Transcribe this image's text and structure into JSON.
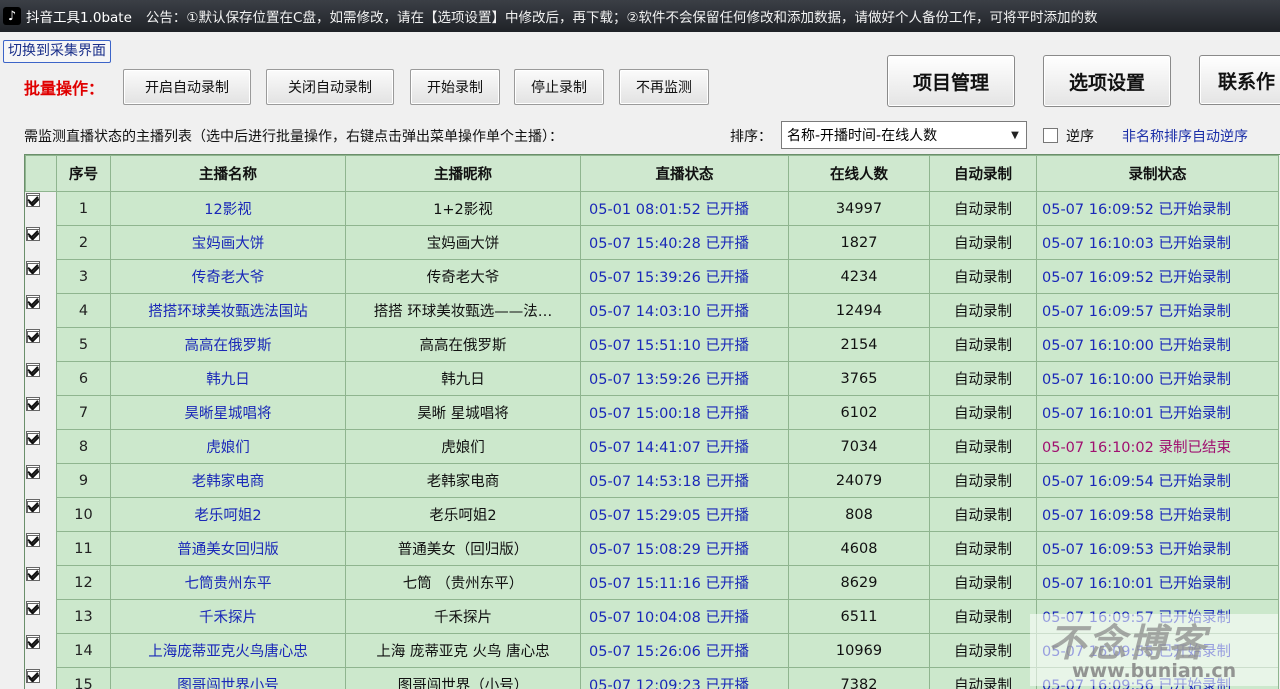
{
  "titlebar": {
    "app_title": "抖音工具1.0bate",
    "notice": "公告：①默认保存位置在C盘，如需修改，请在【选项设置】中修改后，再下载；②软件不会保留任何修改和添加数据，请做好个人备份工作，可将平时添加的数"
  },
  "switch_button": "切换到采集界面",
  "batch": {
    "label": "批量操作：",
    "buttons": [
      "开启自动录制",
      "关闭自动录制",
      "开始录制",
      "停止录制",
      "不再监测"
    ]
  },
  "top_buttons": [
    "项目管理",
    "选项设置",
    "联系作"
  ],
  "list_description": "需监测直播状态的主播列表（选中后进行批量操作，右键点击弹出菜单操作单个主播）：",
  "sort": {
    "label": "排序：",
    "value": "名称-开播时间-在线人数",
    "reverse_label": "逆序",
    "note": "非名称排序自动逆序"
  },
  "table": {
    "headers": [
      "",
      "序号",
      "主播名称",
      "主播昵称",
      "直播状态",
      "在线人数",
      "自动录制",
      "录制状态"
    ],
    "rows": [
      {
        "no": "1",
        "name": "12影视",
        "nick": "1+2影视",
        "live": "05-01  08:01:52  已开播",
        "online": "34997",
        "auto": "自动录制",
        "rec": "05-07  16:09:52  已开始录制",
        "ended": false
      },
      {
        "no": "2",
        "name": "宝妈画大饼",
        "nick": "宝妈画大饼",
        "live": "05-07  15:40:28  已开播",
        "online": "1827",
        "auto": "自动录制",
        "rec": "05-07  16:10:03  已开始录制",
        "ended": false
      },
      {
        "no": "3",
        "name": "传奇老大爷",
        "nick": "传奇老大爷",
        "live": "05-07  15:39:26  已开播",
        "online": "4234",
        "auto": "自动录制",
        "rec": "05-07  16:09:52  已开始录制",
        "ended": false
      },
      {
        "no": "4",
        "name": "搭搭环球美妆甄选法国站",
        "nick": "搭搭  环球美妆甄选——法…",
        "live": "05-07  14:03:10  已开播",
        "online": "12494",
        "auto": "自动录制",
        "rec": "05-07  16:09:57  已开始录制",
        "ended": false
      },
      {
        "no": "5",
        "name": "高高在俄罗斯",
        "nick": "高高在俄罗斯",
        "live": "05-07  15:51:10  已开播",
        "online": "2154",
        "auto": "自动录制",
        "rec": "05-07  16:10:00  已开始录制",
        "ended": false
      },
      {
        "no": "6",
        "name": "韩九日",
        "nick": "韩九日",
        "live": "05-07  13:59:26  已开播",
        "online": "3765",
        "auto": "自动录制",
        "rec": "05-07  16:10:00  已开始录制",
        "ended": false
      },
      {
        "no": "7",
        "name": "昊晰星城唱将",
        "nick": "昊晰  星城唱将",
        "live": "05-07  15:00:18  已开播",
        "online": "6102",
        "auto": "自动录制",
        "rec": "05-07  16:10:01  已开始录制",
        "ended": false
      },
      {
        "no": "8",
        "name": "虎娘们",
        "nick": "虎娘们",
        "live": "05-07  14:41:07  已开播",
        "online": "7034",
        "auto": "自动录制",
        "rec": "05-07  16:10:02  录制已结束",
        "ended": true
      },
      {
        "no": "9",
        "name": "老韩家电商",
        "nick": "老韩家电商",
        "live": "05-07  14:53:18  已开播",
        "online": "24079",
        "auto": "自动录制",
        "rec": "05-07  16:09:54  已开始录制",
        "ended": false
      },
      {
        "no": "10",
        "name": "老乐呵姐2",
        "nick": "老乐呵姐2",
        "live": "05-07  15:29:05  已开播",
        "online": "808",
        "auto": "自动录制",
        "rec": "05-07  16:09:58  已开始录制",
        "ended": false
      },
      {
        "no": "11",
        "name": "普通美女回归版",
        "nick": "普通美女（回归版）",
        "live": "05-07  15:08:29  已开播",
        "online": "4608",
        "auto": "自动录制",
        "rec": "05-07  16:09:53  已开始录制",
        "ended": false
      },
      {
        "no": "12",
        "name": "七筒贵州东平",
        "nick": "七筒   （贵州东平）",
        "live": "05-07  15:11:16  已开播",
        "online": "8629",
        "auto": "自动录制",
        "rec": "05-07  16:10:01  已开始录制",
        "ended": false
      },
      {
        "no": "13",
        "name": "千禾探片",
        "nick": "千禾探片",
        "live": "05-07  10:04:08  已开播",
        "online": "6511",
        "auto": "自动录制",
        "rec": "05-07  16:09:57  已开始录制",
        "ended": false
      },
      {
        "no": "14",
        "name": "上海庞蒂亚克火鸟唐心忠",
        "nick": "上海  庞蒂亚克  火鸟  唐心忠",
        "live": "05-07  15:26:06  已开播",
        "online": "10969",
        "auto": "自动录制",
        "rec": "05-07  16:09:55  已开始录制",
        "ended": false
      },
      {
        "no": "15",
        "name": "图哥闯世界小号",
        "nick": "图哥闯世界（小号）",
        "live": "05-07  12:09:23  已开播",
        "online": "7382",
        "auto": "自动录制",
        "rec": "05-07  16:09:56  已开始录制",
        "ended": false
      }
    ]
  },
  "watermark": {
    "title": "不念博客",
    "url": "www.bunian.cn"
  }
}
